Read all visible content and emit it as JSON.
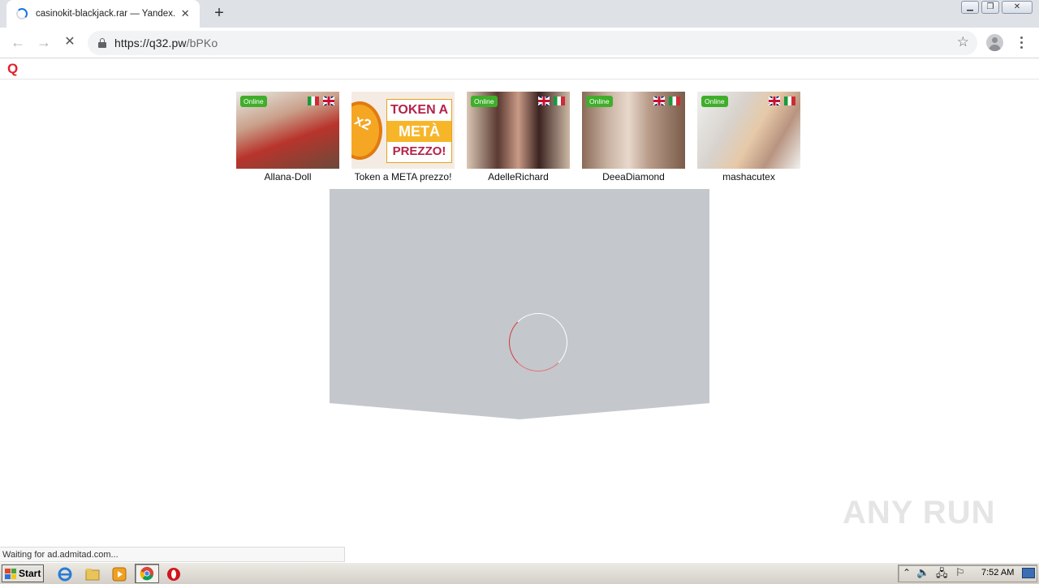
{
  "browser": {
    "tab_title": "casinokit-blackjack.rar — Yandex.Disk",
    "url_host": "https://q32.pw",
    "url_path": "/bPKo",
    "status_text": "Waiting for ad.admitad.com..."
  },
  "site": {
    "logo": "Q",
    "thumbnails": [
      {
        "name": "Allana-Doll",
        "online": "Online",
        "flags": [
          "it",
          "uk"
        ],
        "color": "#b86a5a"
      },
      {
        "name": "Token a META prezzo!",
        "promo": [
          "TOKEN A",
          "METÀ",
          "PREZZO!"
        ],
        "promo_badge": "x2"
      },
      {
        "name": "AdelleRichard",
        "online": "Online",
        "flags": [
          "uk",
          "it"
        ],
        "color": "#5b3a32"
      },
      {
        "name": "DeeaDiamond",
        "online": "Online",
        "flags": [
          "uk",
          "it"
        ],
        "color": "#b89b88"
      },
      {
        "name": "mashacutex",
        "online": "Online",
        "flags": [
          "uk",
          "it"
        ],
        "color": "#d8d2cc"
      }
    ],
    "ad_panel_color": "#c4c7cc"
  },
  "watermark": "ANY RUN",
  "taskbar": {
    "start_label": "Start",
    "clock": "7:52 AM"
  },
  "icons": {
    "back": "←",
    "forward": "→",
    "reload": "✕",
    "star": "☆",
    "new_tab": "+",
    "close_tab": "✕"
  }
}
